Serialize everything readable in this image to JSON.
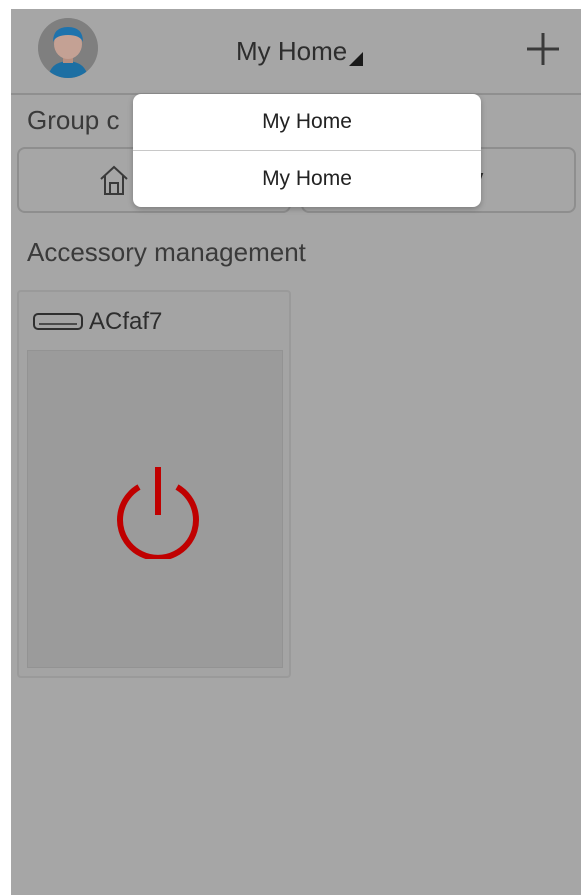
{
  "header": {
    "title": "My Home",
    "avatar_icon": "user-avatar-icon",
    "add_icon": "plus-icon"
  },
  "groups": {
    "label": "Group c",
    "buttons": [
      {
        "icon": "home-icon",
        "label": ""
      },
      {
        "icon": "",
        "label": "ay"
      }
    ]
  },
  "accessories": {
    "label": "Accessory management",
    "devices": [
      {
        "icon": "air-conditioner-icon",
        "name": "ACfaf7",
        "power_icon": "power-icon",
        "power_color": "#c00000"
      }
    ]
  },
  "dropdown": {
    "items": [
      "My Home",
      "My Home"
    ]
  },
  "colors": {
    "overlay_bg": "#a6a6a6",
    "dropdown_bg": "#ffffff",
    "power_red": "#c00000"
  }
}
